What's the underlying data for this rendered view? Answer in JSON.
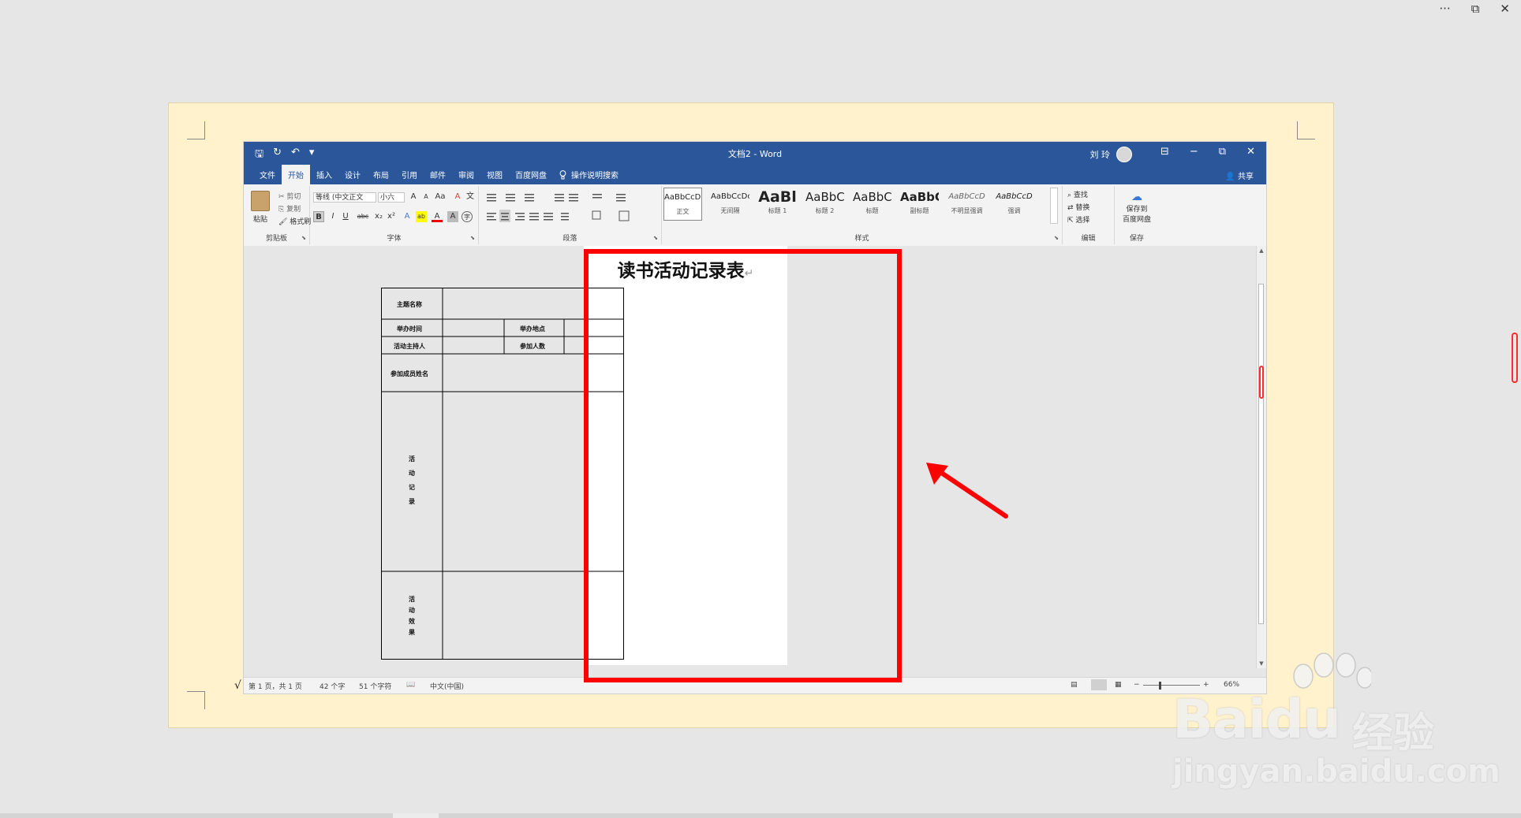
{
  "outer_window": {
    "more_icon": "···",
    "restore_icon": "⧉",
    "close_icon": "✕"
  },
  "app": {
    "title": "文档2 - Word",
    "user": "刘 玲",
    "qat": {
      "save_icon": "🖫",
      "redo_icon": "↻",
      "undo_icon": "↶",
      "dropdown_icon": "▾"
    },
    "window_buttons": {
      "ribbon_display": "⊟",
      "minimize": "−",
      "restore": "⧉",
      "close": "✕"
    },
    "tabs": [
      "文件",
      "开始",
      "插入",
      "设计",
      "布局",
      "引用",
      "邮件",
      "审阅",
      "视图",
      "百度网盘"
    ],
    "active_tab": "开始",
    "tell_me": "操作说明搜索",
    "share": "共享"
  },
  "ribbon": {
    "clipboard": {
      "label": "剪贴板",
      "paste": "粘贴",
      "cut": "剪切",
      "copy": "复制",
      "format_painter": "格式刷"
    },
    "font": {
      "label": "字体",
      "font_name": "等线 (中文正文",
      "font_size": "小六",
      "bold": "B",
      "italic": "I",
      "underline": "U",
      "strike": "abc",
      "subscript": "x₂",
      "superscript": "x²",
      "grow": "A",
      "shrink": "A",
      "case": "Aa",
      "clear": "A",
      "phonetic": "文",
      "border": "A",
      "effects": "A",
      "highlight": "ab",
      "color": "A",
      "shade": "A",
      "enclose": "字"
    },
    "paragraph": {
      "label": "段落"
    },
    "styles": {
      "label": "样式",
      "items": [
        {
          "sample": "AaBbCcDc",
          "name": "正文"
        },
        {
          "sample": "AaBbCcDc",
          "name": "无间隔"
        },
        {
          "sample": "AaBl",
          "name": "标题 1"
        },
        {
          "sample": "AaBbC",
          "name": "标题 2"
        },
        {
          "sample": "AaBbC",
          "name": "标题"
        },
        {
          "sample": "AaBbC",
          "name": "副标题"
        },
        {
          "sample": "AaBbCcD",
          "name": "不明显强调"
        },
        {
          "sample": "AaBbCcD",
          "name": "强调"
        }
      ]
    },
    "editing": {
      "label": "编辑",
      "find": "查找",
      "replace": "替换",
      "select": "选择"
    },
    "save": {
      "label": "保存",
      "button_line1": "保存到",
      "button_line2": "百度网盘"
    }
  },
  "document": {
    "title": "读书活动记录表",
    "para_mark": "↵",
    "table": {
      "topic": "主题名称",
      "time": "举办时间",
      "place": "举办地点",
      "host": "活动主持人",
      "count": "参加人数",
      "members": "参加成员姓名",
      "record": [
        "活",
        "动",
        "记",
        "录"
      ],
      "effect": [
        "活",
        "动",
        "效",
        "果"
      ]
    }
  },
  "status": {
    "page": "第 1 页，共 1 页",
    "words": "42 个字",
    "chars": "51 个字符",
    "language": "中文(中国)",
    "zoom": "66%",
    "zoom_minus": "−",
    "zoom_plus": "+"
  },
  "outside": {
    "checkmark": "√"
  },
  "watermark": {
    "brand": "Bai",
    "brand_tail": "du",
    "cn": "经验",
    "url": "jingyan.baidu.com"
  },
  "colors": {
    "word_blue": "#2b579a",
    "highlight_red": "#ff0000",
    "page_cream": "#fff2cc"
  }
}
